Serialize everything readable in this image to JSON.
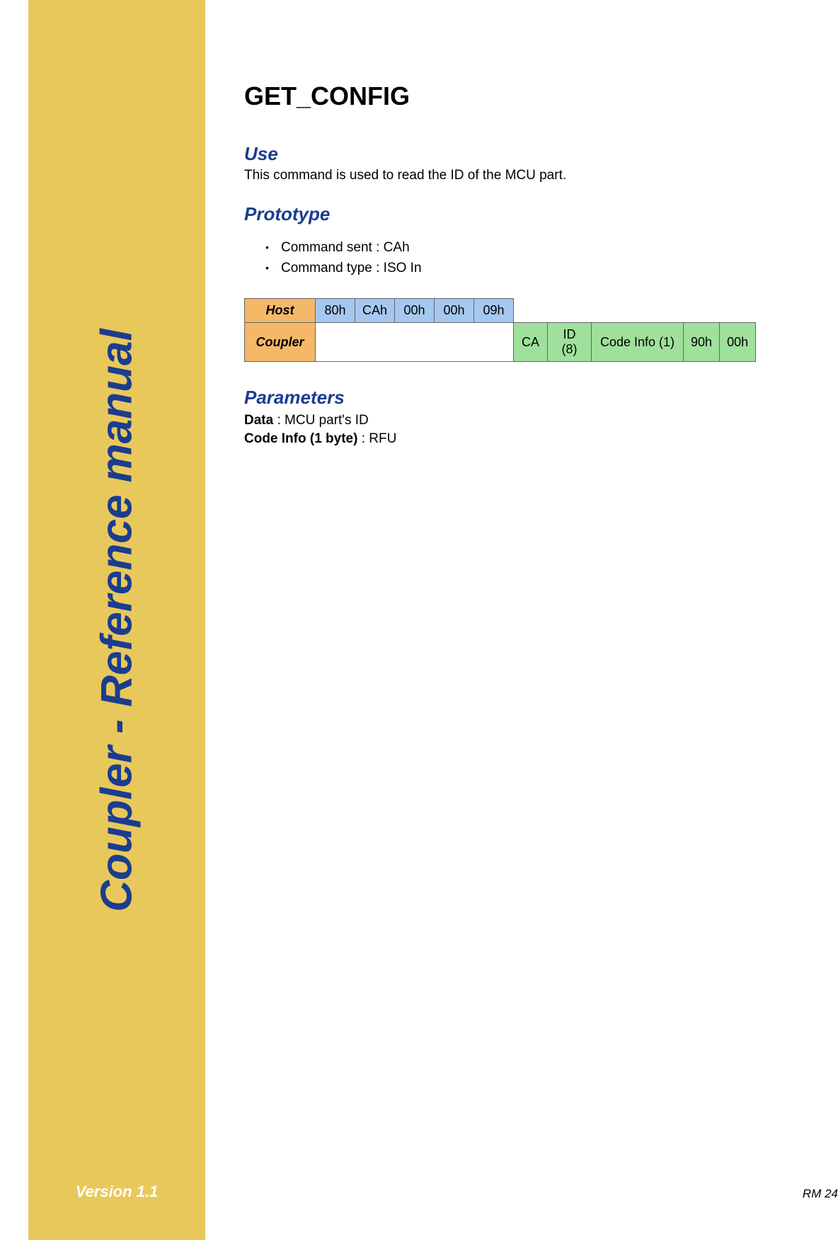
{
  "sidebar": {
    "title": "Coupler - Reference manual",
    "version": "Version 1.1"
  },
  "page": {
    "title": "GET_CONFIG",
    "footer": "RM 24"
  },
  "use": {
    "heading": "Use",
    "text": "This command is used to read the ID of the MCU part."
  },
  "prototype": {
    "heading": "Prototype",
    "bullets": [
      "Command sent : CAh",
      "Command type : ISO In"
    ],
    "table": {
      "row1_label": "Host",
      "row1_cells": [
        "80h",
        "CAh",
        "00h",
        "00h",
        "09h"
      ],
      "row2_label": "Coupler",
      "row2_cells": [
        "CA",
        "ID (8)",
        "Code Info (1)",
        "90h",
        "00h"
      ]
    }
  },
  "parameters": {
    "heading": "Parameters",
    "line1_label": "Data",
    "line1_value": " : MCU part's ID",
    "line2_label": "Code Info (1 byte)",
    "line2_value": " : RFU"
  }
}
